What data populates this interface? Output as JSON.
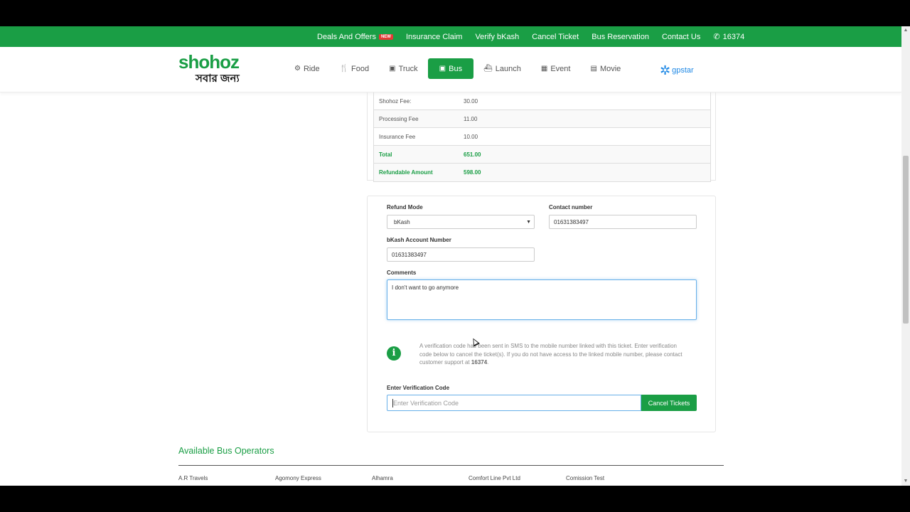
{
  "topbar": {
    "links": [
      {
        "label": "Deals And Offers",
        "badge": "NEW"
      },
      {
        "label": "Insurance Claim"
      },
      {
        "label": "Verify bKash"
      },
      {
        "label": "Cancel Ticket"
      },
      {
        "label": "Bus Reservation"
      },
      {
        "label": "Contact Us"
      },
      {
        "label": "16374",
        "icon": "phone-icon"
      }
    ]
  },
  "brand": {
    "name": "shohoz",
    "tagline": "সবার জন্য"
  },
  "nav": {
    "items": [
      {
        "label": "Ride",
        "icon": "motorbike-icon",
        "active": false
      },
      {
        "label": "Food",
        "icon": "cutlery-icon",
        "active": false
      },
      {
        "label": "Truck",
        "icon": "truck-icon",
        "active": false
      },
      {
        "label": "Bus",
        "icon": "bus-icon",
        "active": true
      },
      {
        "label": "Launch",
        "icon": "ship-icon",
        "active": false
      },
      {
        "label": "Event",
        "icon": "calendar-icon",
        "active": false
      },
      {
        "label": "Movie",
        "icon": "film-icon",
        "active": false
      }
    ],
    "partner": "gpstar"
  },
  "fees": {
    "rows": [
      {
        "label": "Shohoz Fee:",
        "value": "30.00",
        "highlight": false
      },
      {
        "label": "Processing Fee",
        "value": "11.00",
        "highlight": false
      },
      {
        "label": "Insurance Fee",
        "value": "10.00",
        "highlight": false
      },
      {
        "label": "Total",
        "value": "651.00",
        "highlight": true
      },
      {
        "label": "Refundable Amount",
        "value": "598.00",
        "highlight": true
      }
    ]
  },
  "refund_form": {
    "refund_mode_label": "Refund Mode",
    "refund_mode_value": "bKash",
    "contact_label": "Contact number",
    "contact_value": "01631383497",
    "bkash_label": "bKash Account Number",
    "bkash_value": "01631383497",
    "comments_label": "Comments",
    "comments_value": "I don't want to go anymore",
    "info_text_1": "A verification code has been sent in SMS to the mobile number linked with this ticket. Enter verification code below to cancel the ticket(s). If you do not have access to the linked mobile number, please contact customer support at ",
    "info_support_number": "16374",
    "info_text_2": ".",
    "verification_label": "Enter Verification Code",
    "verification_placeholder": "Enter Verification Code",
    "cancel_button": "Cancel Tickets"
  },
  "operators": {
    "title": "Available Bus Operators",
    "names": [
      "A.R Travels",
      "Agomony Express",
      "Alhamra",
      "Comfort Line Pvt Ltd",
      "Comission Test"
    ]
  },
  "colors": {
    "brand_green": "#1a9e45",
    "focus_blue": "#66afe9",
    "badge_red": "#e53935"
  }
}
